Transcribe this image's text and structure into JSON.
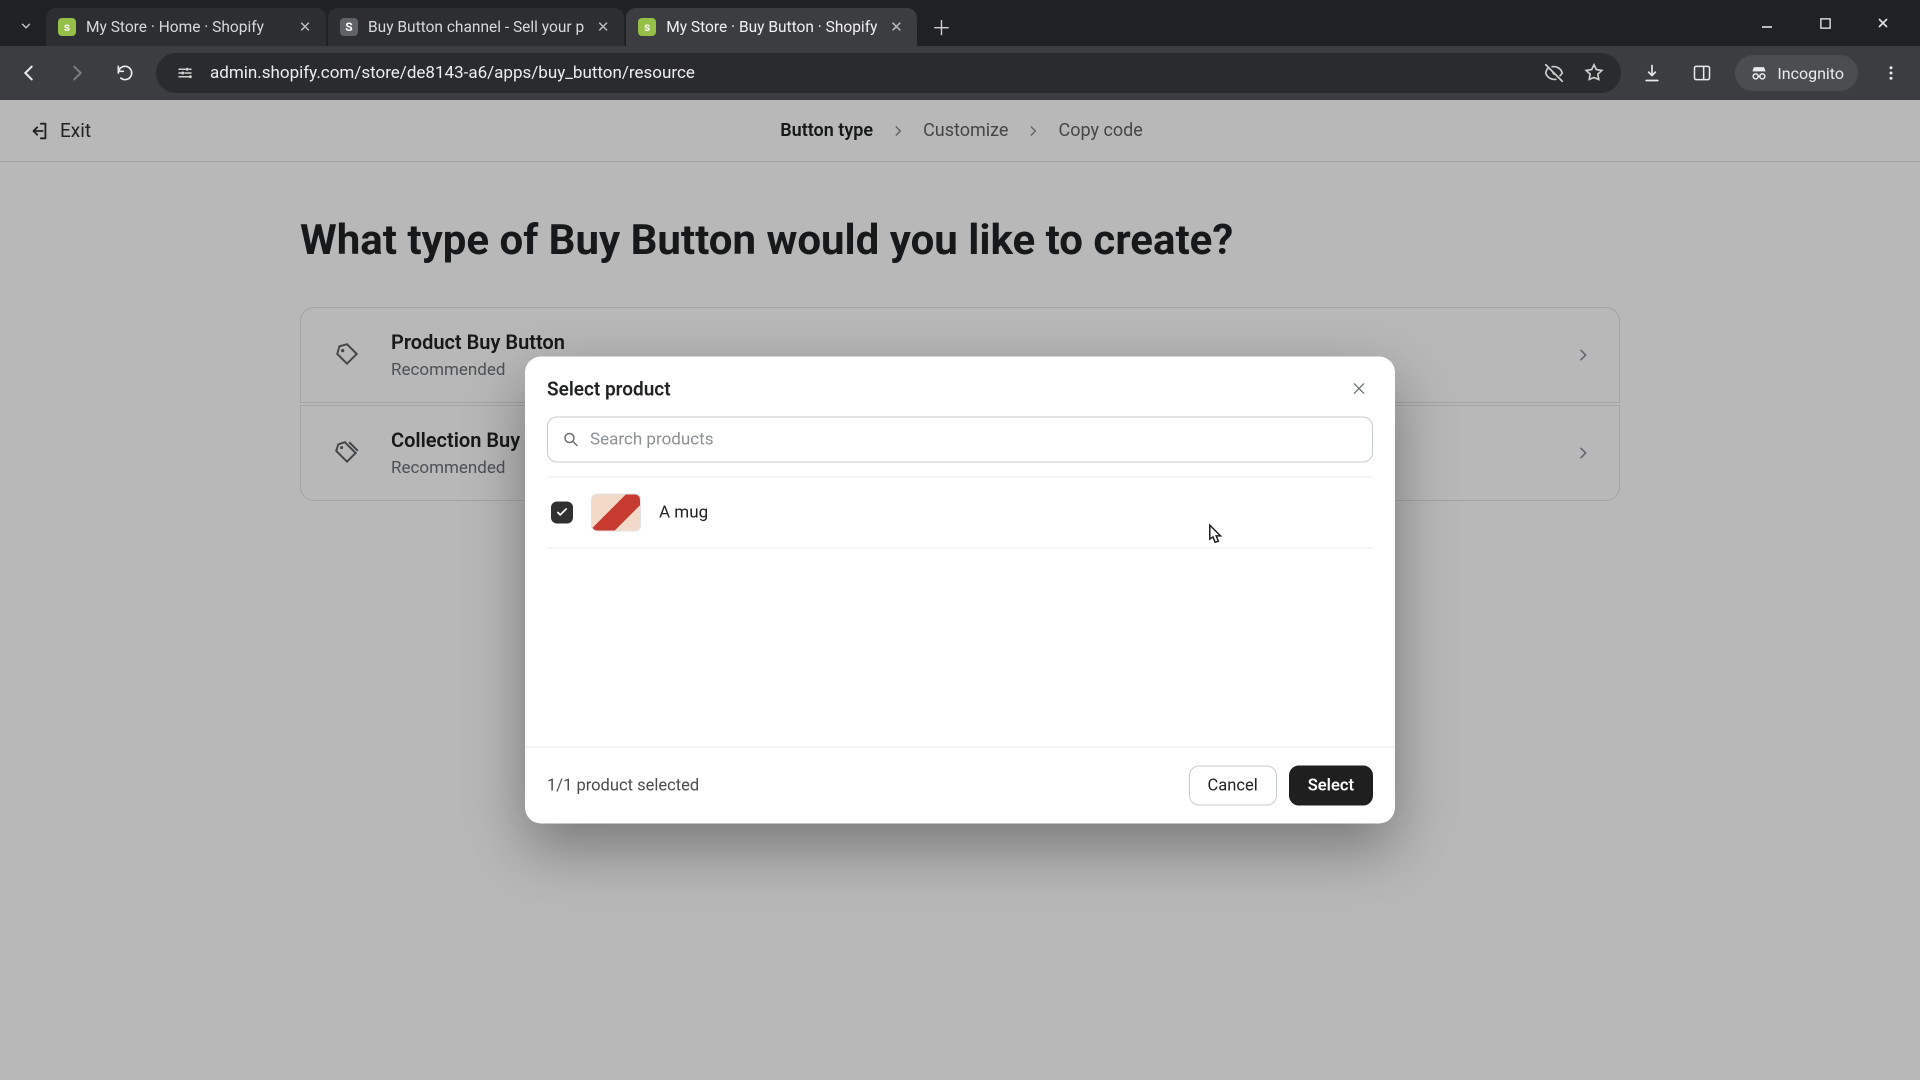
{
  "browser": {
    "tabs": [
      {
        "title": "My Store · Home · Shopify",
        "favicon": "shopify",
        "active": false
      },
      {
        "title": "Buy Button channel - Sell your p",
        "favicon": "generic",
        "active": false
      },
      {
        "title": "My Store · Buy Button · Shopify",
        "favicon": "shopify",
        "active": true
      }
    ],
    "url": "admin.shopify.com/store/de8143-a6/apps/buy_button/resource",
    "incognito_label": "Incognito"
  },
  "appbar": {
    "exit_label": "Exit",
    "steps": [
      "Button type",
      "Customize",
      "Copy code"
    ],
    "active_step_index": 0
  },
  "page": {
    "headline": "What type of Buy Button would you like to create?",
    "cards": [
      {
        "title": "Product Buy Button",
        "subtitle": "Recommended"
      },
      {
        "title": "Collection Buy Button",
        "subtitle": "Recommended"
      }
    ]
  },
  "modal": {
    "title": "Select product",
    "search_placeholder": "Search products",
    "products": [
      {
        "name": "A mug",
        "checked": true
      }
    ],
    "selected_text": "1/1 product selected",
    "cancel_label": "Cancel",
    "select_label": "Select"
  }
}
